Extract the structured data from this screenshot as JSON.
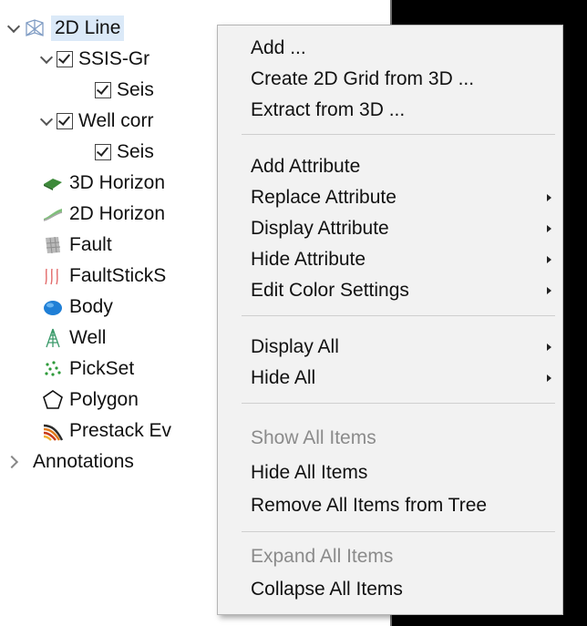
{
  "tree": {
    "items": [
      {
        "label": "2D Line",
        "icon": "2d-line-icon",
        "expanded": true
      },
      {
        "label": "SSIS-Gr",
        "icon": "checkbox",
        "expanded": true
      },
      {
        "label": "Seis",
        "icon": "checkbox"
      },
      {
        "label": "Well corr",
        "icon": "checkbox",
        "expanded": true
      },
      {
        "label": "Seis",
        "icon": "checkbox"
      },
      {
        "label": "3D Horizon",
        "icon": "3d-horizon-icon"
      },
      {
        "label": "2D Horizon",
        "icon": "2d-horizon-icon"
      },
      {
        "label": "Fault",
        "icon": "fault-icon"
      },
      {
        "label": "FaultStickS",
        "icon": "fault-stick-set-icon"
      },
      {
        "label": "Body",
        "icon": "body-icon"
      },
      {
        "label": "Well",
        "icon": "well-icon"
      },
      {
        "label": "PickSet",
        "icon": "pickset-icon"
      },
      {
        "label": "Polygon",
        "icon": "polygon-icon"
      },
      {
        "label": "Prestack Ev",
        "icon": "prestack-events-icon"
      },
      {
        "label": "Annotations",
        "icon": "chevron-right-icon",
        "expanded": false
      }
    ]
  },
  "context_menu": {
    "items": [
      {
        "label": "Add ...",
        "enabled": true,
        "submenu": false
      },
      {
        "label": "Create 2D Grid from 3D ...",
        "enabled": true,
        "submenu": false
      },
      {
        "label": "Extract from 3D ...",
        "enabled": true,
        "submenu": false
      },
      {
        "label": "Add Attribute",
        "enabled": true,
        "submenu": false
      },
      {
        "label": "Replace Attribute",
        "enabled": true,
        "submenu": true
      },
      {
        "label": "Display Attribute",
        "enabled": true,
        "submenu": true
      },
      {
        "label": "Hide Attribute",
        "enabled": true,
        "submenu": true
      },
      {
        "label": "Edit Color Settings",
        "enabled": true,
        "submenu": true
      },
      {
        "label": "Display All",
        "enabled": true,
        "submenu": true
      },
      {
        "label": "Hide All",
        "enabled": true,
        "submenu": true
      },
      {
        "label": "Show All Items",
        "enabled": false,
        "submenu": false
      },
      {
        "label": "Hide All Items",
        "enabled": true,
        "submenu": false
      },
      {
        "label": "Remove All Items from Tree",
        "enabled": true,
        "submenu": false
      },
      {
        "label": "Expand All Items",
        "enabled": false,
        "submenu": false
      },
      {
        "label": "Collapse All Items",
        "enabled": true,
        "submenu": false
      }
    ]
  },
  "colors": {
    "viewport_bg": "#000000",
    "menu_bg": "#f2f2f2",
    "disabled_text": "#8b8b8b",
    "selection_bg": "#dbe9f8"
  }
}
